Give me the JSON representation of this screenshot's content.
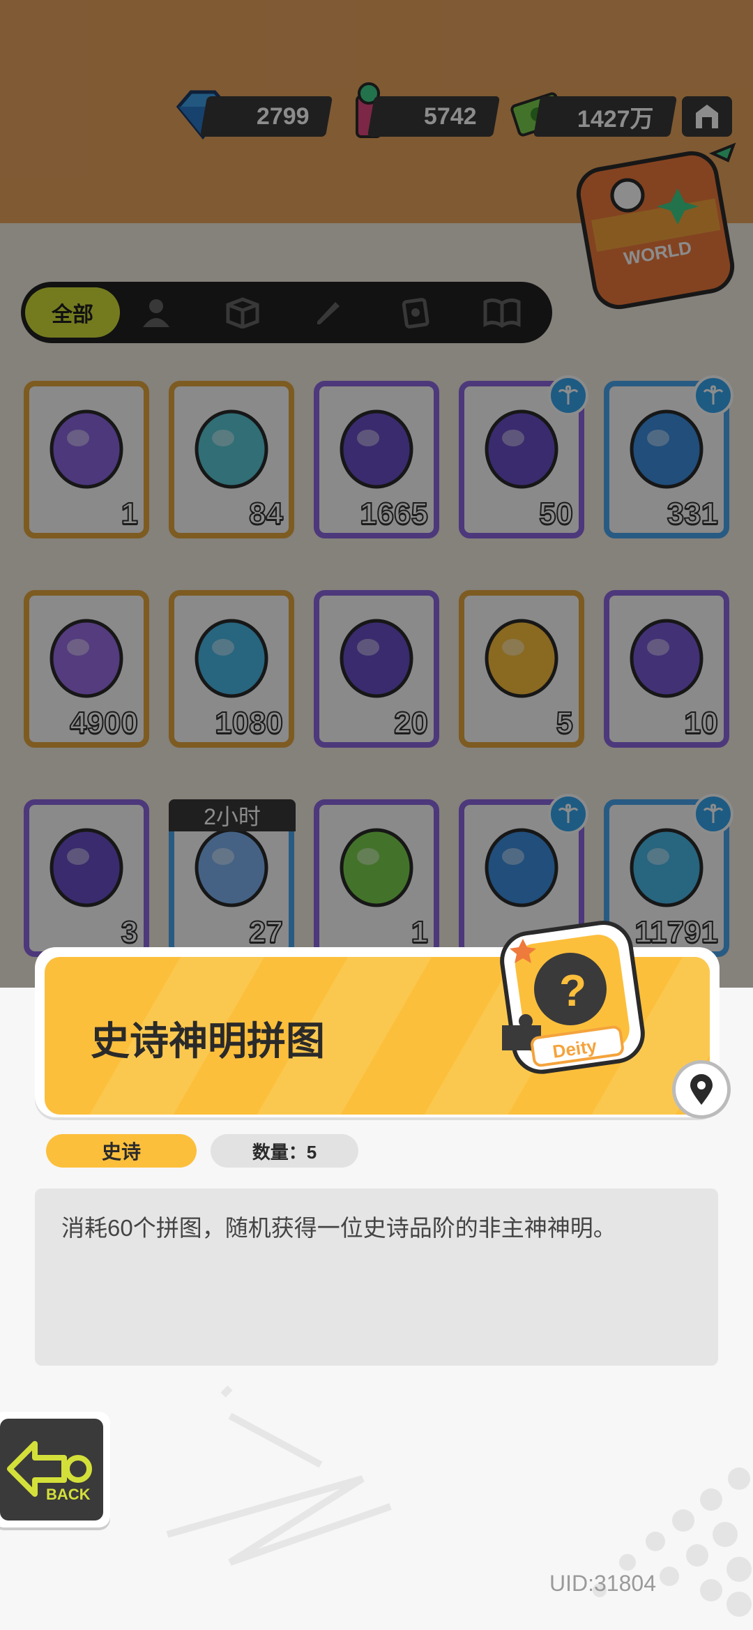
{
  "currencies": [
    {
      "icon": "diamond-icon",
      "value": "2799"
    },
    {
      "icon": "energy-drink-icon",
      "value": "5742"
    },
    {
      "icon": "cash-icon",
      "value": "1427万"
    }
  ],
  "tabs": {
    "all_label": "全部",
    "others": [
      "person-icon",
      "box-icon",
      "pencil-icon",
      "card-icon",
      "book-icon"
    ]
  },
  "world_badge_label": "WORLD",
  "timer_label": "2小时",
  "items": [
    {
      "name": "ticket-item",
      "qty": "1",
      "rarity": "gold"
    },
    {
      "name": "rainbow-leaf-item",
      "qty": "84",
      "rarity": "gold"
    },
    {
      "name": "purple-star-item",
      "qty": "1665",
      "rarity": "purple"
    },
    {
      "name": "purple-crayon-item",
      "qty": "50",
      "rarity": "purple",
      "palm": true
    },
    {
      "name": "blue-crayon-item",
      "qty": "331",
      "rarity": "blue",
      "palm": true
    },
    {
      "name": "cool-sticker-item",
      "qty": "4900",
      "rarity": "gold"
    },
    {
      "name": "face-sticker-item",
      "qty": "1080",
      "rarity": "gold"
    },
    {
      "name": "purple-mystery-puzzle-item",
      "qty": "20",
      "rarity": "purple"
    },
    {
      "name": "epic-deity-puzzle-item",
      "qty": "5",
      "rarity": "gold"
    },
    {
      "name": "travel-card-item",
      "qty": "10",
      "rarity": "purple"
    },
    {
      "name": "yellow-orb-item",
      "qty": "3",
      "rarity": "purple"
    },
    {
      "name": "alarm-clock-item",
      "qty": "27",
      "rarity": "blue"
    },
    {
      "name": "green-cup-item",
      "qty": "1",
      "rarity": "purple"
    },
    {
      "name": "spray-can-item",
      "qty": "",
      "rarity": "purple",
      "palm": true
    },
    {
      "name": "paint-tube-item",
      "qty": "11791",
      "rarity": "blue",
      "palm": true
    }
  ],
  "detail": {
    "title": "史诗神明拼图",
    "rarity_tag": "史诗",
    "quantity_tag": "数量：5",
    "description": "消耗60个拼图，随机获得一位史诗品阶的非主神神明。",
    "badge_text": "Deity"
  },
  "back_label": "BACK",
  "uid": "UID:31804",
  "colors": {
    "gold": "#e3a63d",
    "purple": "#8a66e0",
    "blue": "#4aa6ee",
    "banner": "#fcbf3c",
    "tab_active": "#d4e03a"
  }
}
